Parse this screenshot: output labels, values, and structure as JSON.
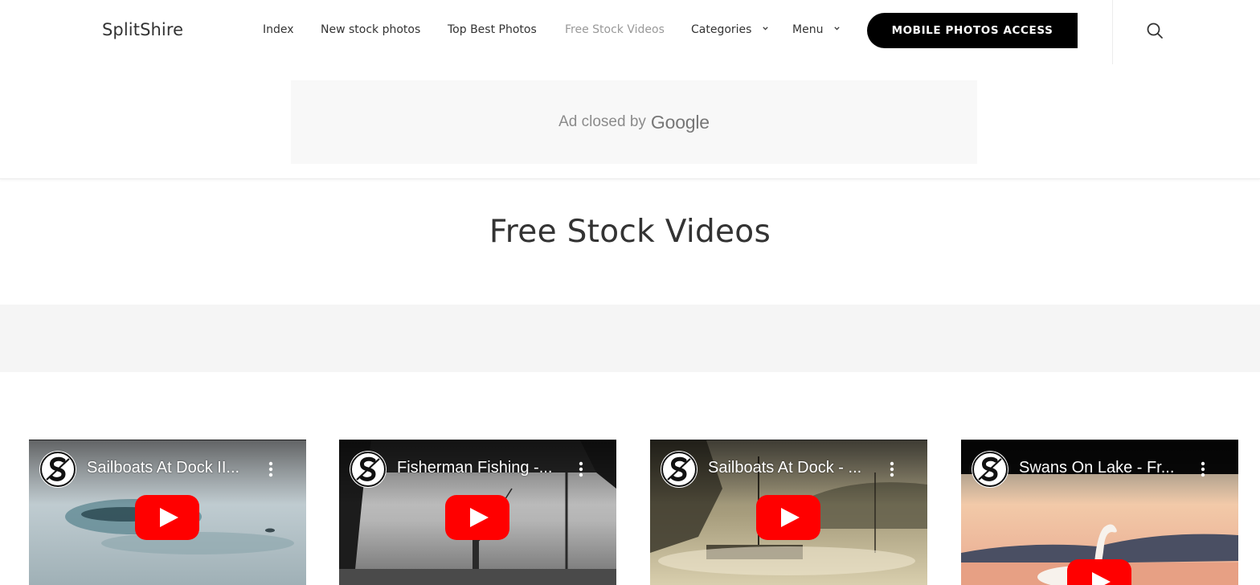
{
  "header": {
    "logo": "SplitShire",
    "nav": [
      {
        "label": "Index",
        "active": false,
        "dropdown": false
      },
      {
        "label": "New stock photos",
        "active": false,
        "dropdown": false
      },
      {
        "label": "Top Best Photos",
        "active": false,
        "dropdown": false
      },
      {
        "label": "Free Stock Videos",
        "active": true,
        "dropdown": false
      },
      {
        "label": "Categories",
        "active": false,
        "dropdown": true
      },
      {
        "label": "Menu",
        "active": false,
        "dropdown": true
      }
    ],
    "cta_label": "MOBILE PHOTOS ACCESS",
    "search_icon": "search-icon"
  },
  "ad": {
    "text": "Ad closed by",
    "brand": "Google"
  },
  "page_title": "Free Stock Videos",
  "videos": [
    {
      "title": "Sailboats At Dock II...",
      "icon": "youtube-play-icon"
    },
    {
      "title": "Fisherman Fishing -...",
      "icon": "youtube-play-icon"
    },
    {
      "title": "Sailboats At Dock - ...",
      "icon": "youtube-play-icon"
    },
    {
      "title": "Swans On Lake - Fr...",
      "icon": "youtube-play-icon"
    }
  ],
  "colors": {
    "accent_button": "#000000",
    "active_nav": "#999999",
    "youtube_red": "#ff0000"
  }
}
